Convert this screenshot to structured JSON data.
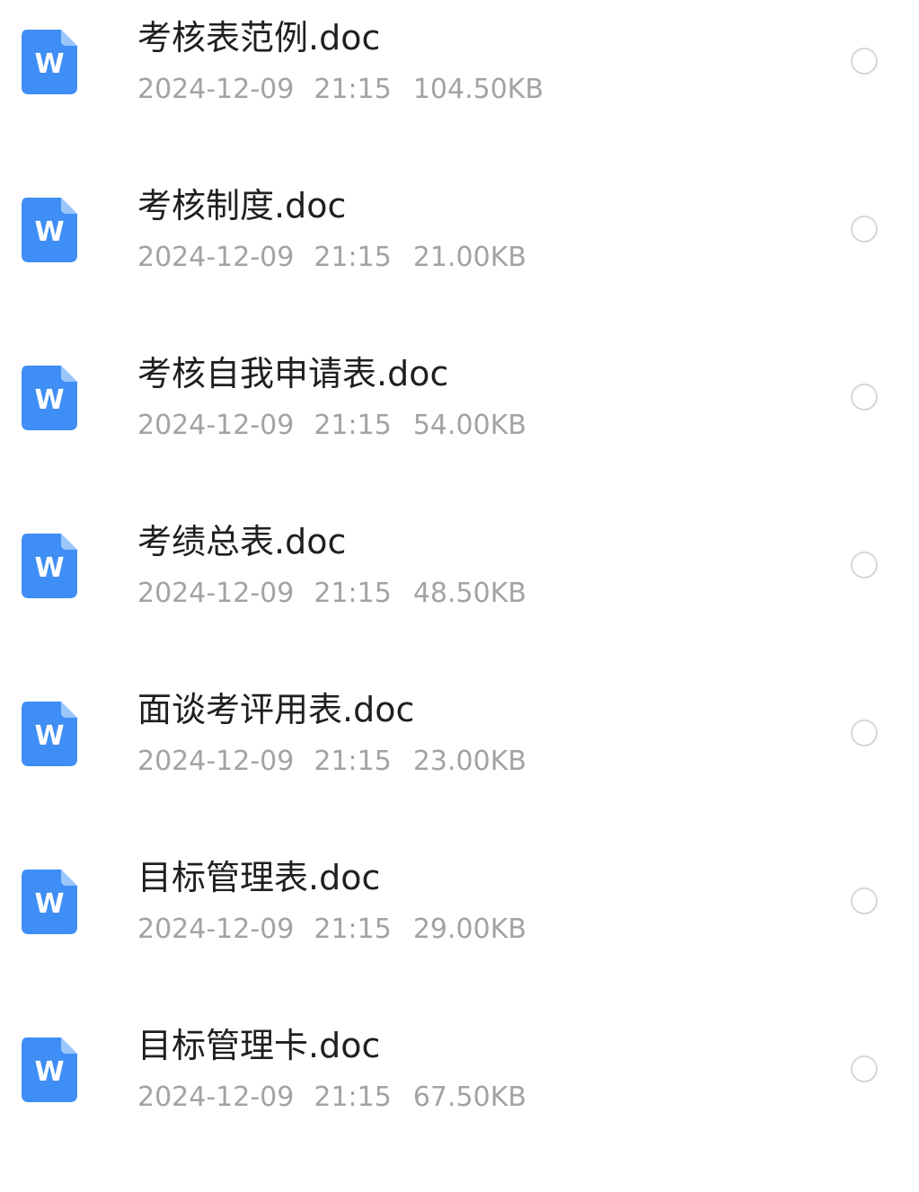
{
  "colors": {
    "icon_blue": "#3f8ef5",
    "icon_fold": "#9cc6fb",
    "name_text": "#1f1f1f",
    "meta_text": "#a3a3a3",
    "radio_border": "#d6d6d6"
  },
  "icon": {
    "name": "word-document-icon",
    "letter": "W"
  },
  "files": [
    {
      "name": "考核表范例.doc",
      "date": "2024-12-09",
      "time": "21:15",
      "size": "104.50KB",
      "selected": false
    },
    {
      "name": "考核制度.doc",
      "date": "2024-12-09",
      "time": "21:15",
      "size": "21.00KB",
      "selected": false
    },
    {
      "name": "考核自我申请表.doc",
      "date": "2024-12-09",
      "time": "21:15",
      "size": "54.00KB",
      "selected": false
    },
    {
      "name": "考绩总表.doc",
      "date": "2024-12-09",
      "time": "21:15",
      "size": "48.50KB",
      "selected": false
    },
    {
      "name": "面谈考评用表.doc",
      "date": "2024-12-09",
      "time": "21:15",
      "size": "23.00KB",
      "selected": false
    },
    {
      "name": "目标管理表.doc",
      "date": "2024-12-09",
      "time": "21:15",
      "size": "29.00KB",
      "selected": false
    },
    {
      "name": "目标管理卡.doc",
      "date": "2024-12-09",
      "time": "21:15",
      "size": "67.50KB",
      "selected": false
    }
  ]
}
